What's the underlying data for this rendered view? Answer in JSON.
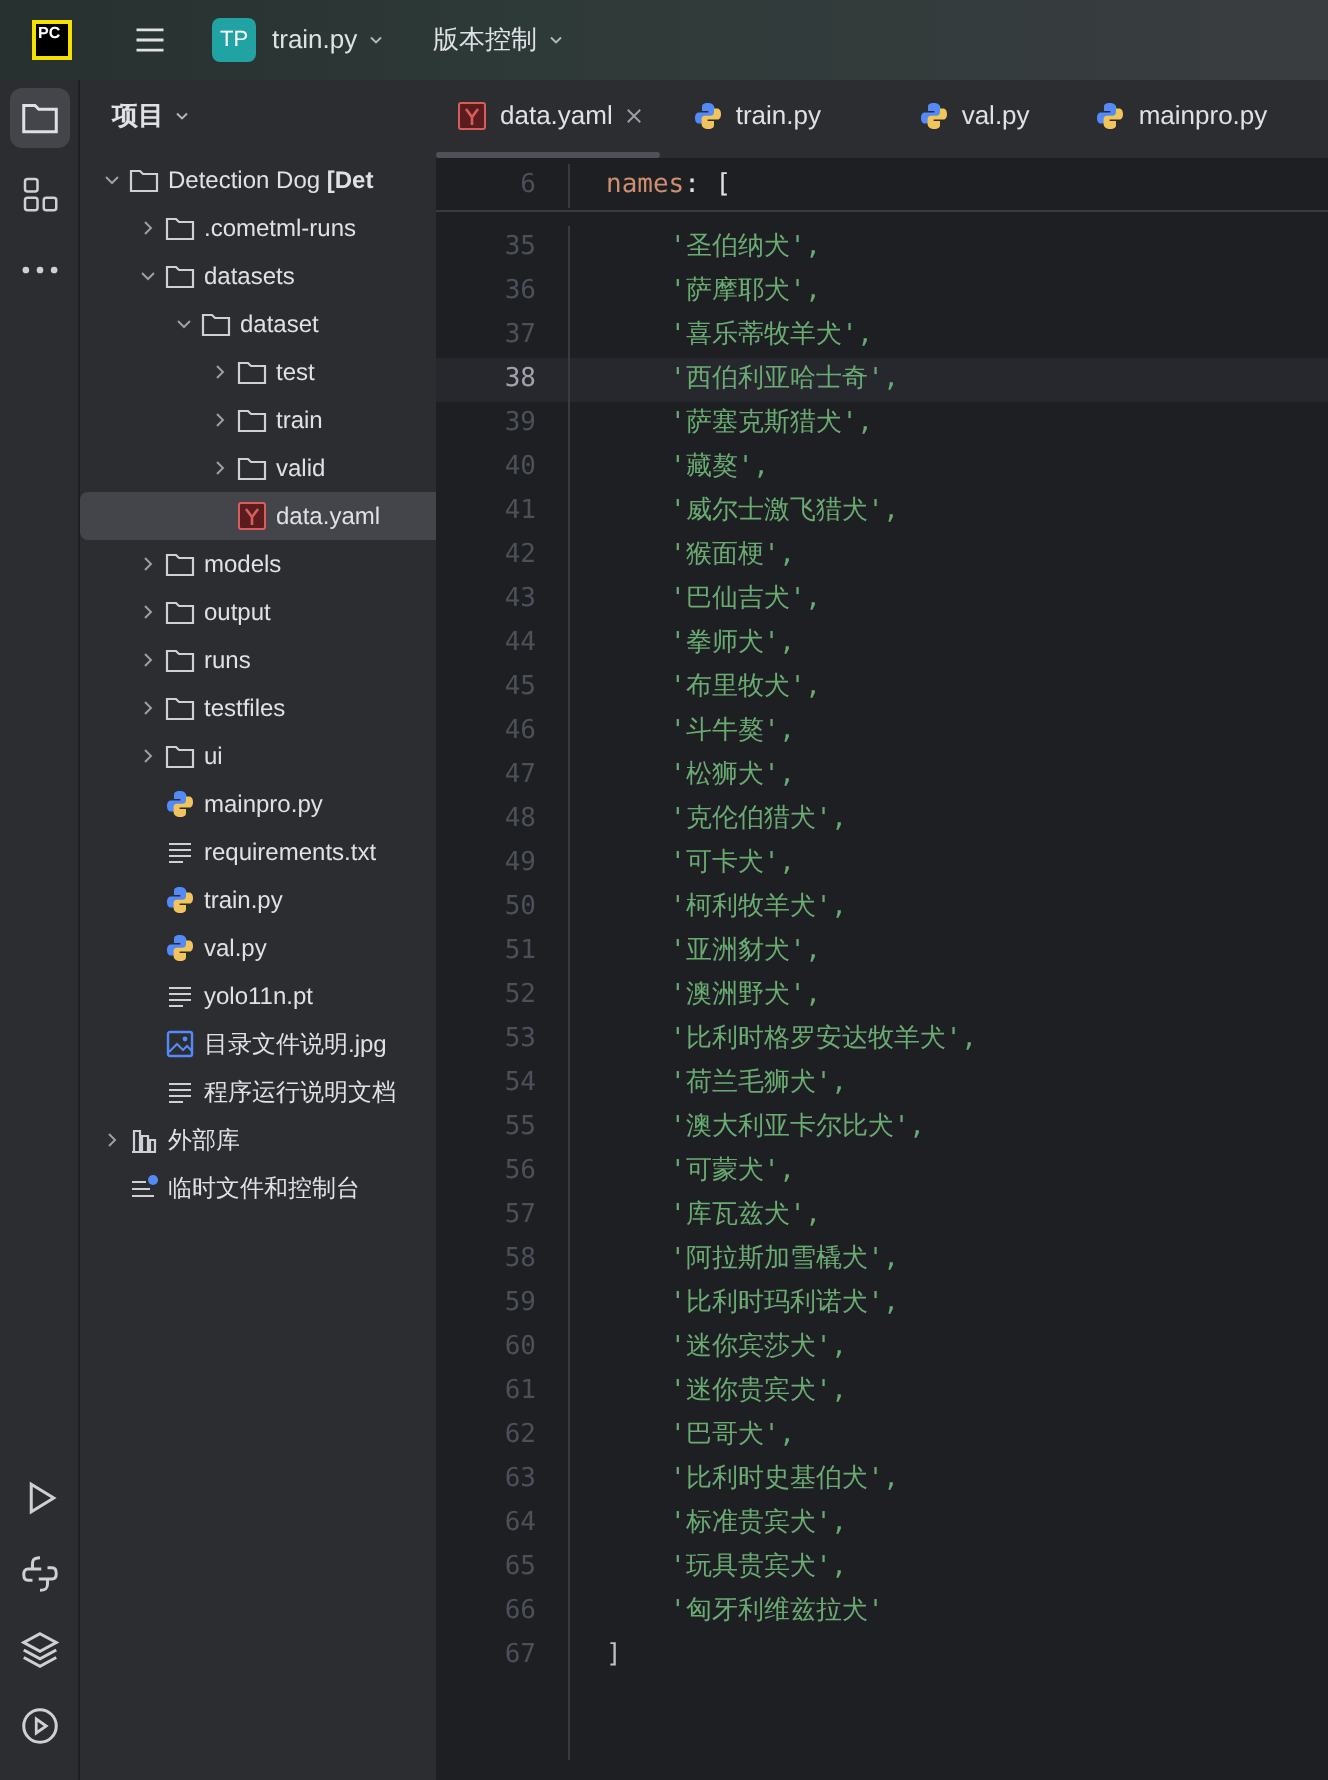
{
  "title_bar": {
    "logo_text": "PC",
    "project_badge": "TP",
    "project": "train.py",
    "vcs": "版本控制"
  },
  "tool_strip": {
    "top": [
      {
        "kind": "project",
        "selected": true
      },
      {
        "kind": "structure",
        "selected": false
      },
      {
        "kind": "more",
        "selected": false
      }
    ],
    "bottom": [
      {
        "kind": "run",
        "selected": false
      },
      {
        "kind": "python",
        "selected": false
      },
      {
        "kind": "layers",
        "selected": false
      },
      {
        "kind": "services",
        "selected": false
      }
    ]
  },
  "project_panel": {
    "title": "项目",
    "tree": [
      {
        "label": "Detection Dog **[Det**",
        "kind": "folder",
        "expanded": true,
        "selected": false,
        "children": [
          {
            "label": ".cometml-runs",
            "kind": "folder",
            "expanded": false,
            "selected": false
          },
          {
            "label": "datasets",
            "kind": "folder",
            "expanded": true,
            "selected": false,
            "children": [
              {
                "label": "dataset",
                "kind": "folder",
                "expanded": true,
                "selected": false,
                "children": [
                  {
                    "label": "test",
                    "kind": "folder",
                    "expanded": false,
                    "selected": false
                  },
                  {
                    "label": "train",
                    "kind": "folder",
                    "expanded": false,
                    "selected": false
                  },
                  {
                    "label": "valid",
                    "kind": "folder",
                    "expanded": false,
                    "selected": false
                  },
                  {
                    "label": "data.yaml",
                    "kind": "yaml",
                    "selected": true
                  }
                ]
              }
            ]
          },
          {
            "label": "models",
            "kind": "folder",
            "expanded": false,
            "selected": false
          },
          {
            "label": "output",
            "kind": "folder",
            "expanded": false,
            "selected": false
          },
          {
            "label": "runs",
            "kind": "folder",
            "expanded": false,
            "selected": false
          },
          {
            "label": "testfiles",
            "kind": "folder",
            "expanded": false,
            "selected": false
          },
          {
            "label": "ui",
            "kind": "folder",
            "expanded": false,
            "selected": false
          },
          {
            "label": "mainpro.py",
            "kind": "python",
            "selected": false
          },
          {
            "label": "requirements.txt",
            "kind": "text",
            "selected": false
          },
          {
            "label": "train.py",
            "kind": "python",
            "selected": false
          },
          {
            "label": "val.py",
            "kind": "python",
            "selected": false
          },
          {
            "label": "yolo11n.pt",
            "kind": "text",
            "selected": false
          },
          {
            "label": "目录文件说明.jpg",
            "kind": "image",
            "selected": false
          },
          {
            "label": "程序运行说明文档",
            "kind": "text",
            "selected": false
          }
        ]
      },
      {
        "label": "外部库",
        "kind": "library",
        "expanded": false,
        "selected": false
      },
      {
        "label": "临时文件和控制台",
        "kind": "scratch",
        "selected": false
      }
    ]
  },
  "tabs": [
    {
      "label": "data.yaml",
      "kind": "yaml",
      "selected": true
    },
    {
      "label": "train.py",
      "kind": "python",
      "selected": false
    },
    {
      "label": "val.py",
      "kind": "python",
      "selected": false
    },
    {
      "label": "mainpro.py",
      "kind": "python",
      "selected": false
    }
  ],
  "sticky_line": {
    "number": "6",
    "key": "names",
    "rest": ": ["
  },
  "lines": [
    {
      "number": "35",
      "kind": "string",
      "text": "'圣伯纳犬',",
      "current": false
    },
    {
      "number": "36",
      "kind": "string",
      "text": "'萨摩耶犬',",
      "current": false
    },
    {
      "number": "37",
      "kind": "string",
      "text": "'喜乐蒂牧羊犬',",
      "current": false
    },
    {
      "number": "38",
      "kind": "string",
      "text": "'西伯利亚哈士奇',",
      "current": true
    },
    {
      "number": "39",
      "kind": "string",
      "text": "'萨塞克斯猎犬',",
      "current": false
    },
    {
      "number": "40",
      "kind": "string",
      "text": "'藏獒',",
      "current": false
    },
    {
      "number": "41",
      "kind": "string",
      "text": "'威尔士激飞猎犬',",
      "current": false
    },
    {
      "number": "42",
      "kind": "string",
      "text": "'猴面梗',",
      "current": false
    },
    {
      "number": "43",
      "kind": "string",
      "text": "'巴仙吉犬',",
      "current": false
    },
    {
      "number": "44",
      "kind": "string",
      "text": "'拳师犬',",
      "current": false
    },
    {
      "number": "45",
      "kind": "string",
      "text": "'布里牧犬',",
      "current": false
    },
    {
      "number": "46",
      "kind": "string",
      "text": "'斗牛獒',",
      "current": false
    },
    {
      "number": "47",
      "kind": "string",
      "text": "'松狮犬',",
      "current": false
    },
    {
      "number": "48",
      "kind": "string",
      "text": "'克伦伯猎犬',",
      "current": false
    },
    {
      "number": "49",
      "kind": "string",
      "text": "'可卡犬',",
      "current": false
    },
    {
      "number": "50",
      "kind": "string",
      "text": "'柯利牧羊犬',",
      "current": false
    },
    {
      "number": "51",
      "kind": "string",
      "text": "'亚洲豺犬',",
      "current": false
    },
    {
      "number": "52",
      "kind": "string",
      "text": "'澳洲野犬',",
      "current": false
    },
    {
      "number": "53",
      "kind": "string",
      "text": "'比利时格罗安达牧羊犬',",
      "current": false
    },
    {
      "number": "54",
      "kind": "string",
      "text": "'荷兰毛狮犬',",
      "current": false
    },
    {
      "number": "55",
      "kind": "string",
      "text": "'澳大利亚卡尔比犬',",
      "current": false
    },
    {
      "number": "56",
      "kind": "string",
      "text": "'可蒙犬',",
      "current": false
    },
    {
      "number": "57",
      "kind": "string",
      "text": "'库瓦兹犬',",
      "current": false
    },
    {
      "number": "58",
      "kind": "string",
      "text": "'阿拉斯加雪橇犬',",
      "current": false
    },
    {
      "number": "59",
      "kind": "string",
      "text": "'比利时玛利诺犬',",
      "current": false
    },
    {
      "number": "60",
      "kind": "string",
      "text": "'迷你宾莎犬',",
      "current": false
    },
    {
      "number": "61",
      "kind": "string",
      "text": "'迷你贵宾犬',",
      "current": false
    },
    {
      "number": "62",
      "kind": "string",
      "text": "'巴哥犬',",
      "current": false
    },
    {
      "number": "63",
      "kind": "string",
      "text": "'比利时史基伯犬',",
      "current": false
    },
    {
      "number": "64",
      "kind": "string",
      "text": "'标准贵宾犬',",
      "current": false
    },
    {
      "number": "65",
      "kind": "string",
      "text": "'玩具贵宾犬',",
      "current": false
    },
    {
      "number": "66",
      "kind": "string",
      "text": "'匈牙利维兹拉犬'",
      "current": false
    },
    {
      "number": "67",
      "kind": "bracket",
      "text": "]",
      "current": false
    }
  ]
}
